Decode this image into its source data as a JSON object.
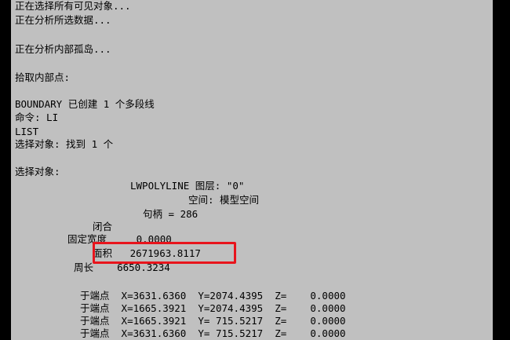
{
  "console": {
    "lines": [
      "正在选择所有可见对象...",
      "正在分析所选数据...",
      "正在分析内部孤岛...",
      "拾取内部点:",
      "BOUNDARY 已创建 1 个多段线",
      "命令: LI",
      "LIST",
      "选择对象: 找到 1 个",
      "选择对象:",
      "LWPOLYLINE 图层: \"0\"",
      "空间: 模型空间",
      "句柄 = 286",
      "闭合",
      "固定宽度     0.0000",
      "面积   2671963.8117",
      "周长    6650.3234",
      "于端点  X=3631.6360  Y=2074.4395  Z=    0.0000",
      "于端点  X=1665.3921  Y=2074.4395  Z=    0.0000",
      "于端点  X=1665.3921  Y= 715.5217  Z=    0.0000",
      "于端点  X=3631.6360  Y= 715.5217  Z=    0.0000"
    ]
  },
  "colors": {
    "console_background": "#c0c0c0",
    "text": "#000000",
    "highlight_border": "#e8141c",
    "outer_background": "#000000"
  }
}
